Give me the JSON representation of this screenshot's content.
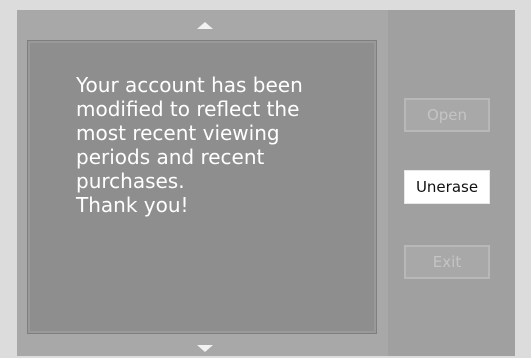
{
  "message": {
    "text": "Your account has been\nmodified to reflect the\nmost recent viewing\nperiods and recent\npurchases.\nThank you!"
  },
  "buttons": {
    "open_label": "Open",
    "unerase_label": "Unerase",
    "exit_label": "Exit"
  },
  "icons": {
    "scroll_up": "scroll-up-arrow-icon",
    "scroll_down": "scroll-down-arrow-icon"
  },
  "colors": {
    "background": "#dcdcdc",
    "panel": "#a8a8a8",
    "message_box": "#8e8e8e",
    "message_text": "#ffffff",
    "active_button": "#ffffff",
    "disabled_button_text": "#c4c4c4"
  }
}
